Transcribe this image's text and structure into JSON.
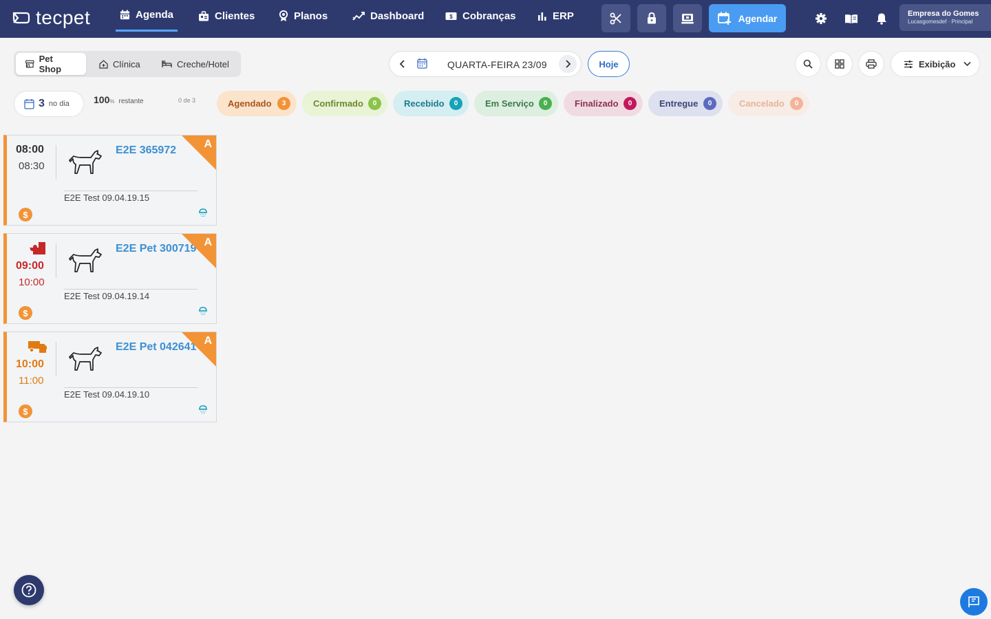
{
  "brand": {
    "logo_text": "tecpet"
  },
  "nav": [
    {
      "label": "Agenda",
      "icon": "calendar-icon",
      "active": true
    },
    {
      "label": "Clientes",
      "icon": "clients-icon"
    },
    {
      "label": "Planos",
      "icon": "badge-icon"
    },
    {
      "label": "Dashboard",
      "icon": "trend-icon"
    },
    {
      "label": "Cobranças",
      "icon": "money-icon"
    },
    {
      "label": "ERP",
      "icon": "bar-chart-icon"
    }
  ],
  "toolbar": {
    "agendar_label": "Agendar",
    "company_name": "Empresa do Gomes",
    "company_sub": "Lucasgomesdef · Principal"
  },
  "segments": [
    {
      "label": "Pet Shop",
      "active": true
    },
    {
      "label": "Clínica"
    },
    {
      "label": "Creche/Hotel"
    }
  ],
  "date_nav": {
    "label": "QUARTA-FEIRA 23/09",
    "today_label": "Hoje"
  },
  "display_label": "Exibição",
  "summary": {
    "count": "3",
    "count_label": "no dia",
    "percent": "100",
    "percent_sign": "%",
    "remaining_label": "restante",
    "of_label": "0 de 3"
  },
  "statuses": [
    {
      "label": "Agendado",
      "count": "3",
      "bg": "#fbe3cc",
      "fg": "#a9561a",
      "badge": "#f29336"
    },
    {
      "label": "Confirmado",
      "count": "0",
      "bg": "#e9f3d6",
      "fg": "#6b8a2d",
      "badge": "#8bc34a"
    },
    {
      "label": "Recebido",
      "count": "0",
      "bg": "#d4eef2",
      "fg": "#1f7a8c",
      "badge": "#17a2b8"
    },
    {
      "label": "Em Serviço",
      "count": "0",
      "bg": "#dcefe0",
      "fg": "#3f7a49",
      "badge": "#4caf50"
    },
    {
      "label": "Finalizado",
      "count": "0",
      "bg": "#f1dbe3",
      "fg": "#8a3254",
      "badge": "#c2185b"
    },
    {
      "label": "Entregue",
      "count": "0",
      "bg": "#dde0ef",
      "fg": "#3d4478",
      "badge": "#5c6bc0"
    },
    {
      "label": "Cancelado",
      "count": "0",
      "bg": "#f7ece6",
      "fg": "#e8b49a",
      "badge": "#f4b39a"
    }
  ],
  "appointments": [
    {
      "start": "08:00",
      "end": "08:30",
      "pet": "E2E 365972",
      "tutor": "E2E Test 09.04.19.15",
      "tag": "A",
      "time_color": "#333333",
      "badge_icon": ""
    },
    {
      "start": "09:00",
      "end": "10:00",
      "pet": "E2E Pet 300719",
      "tutor": "E2E Test 09.04.19.14",
      "tag": "A",
      "time_color": "#c62828",
      "badge_icon": "puzzle-icon"
    },
    {
      "start": "10:00",
      "end": "11:00",
      "pet": "E2E Pet 042641",
      "tutor": "E2E Test 09.04.19.10",
      "tag": "A",
      "time_color": "#e07b12",
      "badge_icon": "truck-icon"
    }
  ],
  "colors": {
    "topbar": "#2e3a6e",
    "accent": "#4a9cf2",
    "card_accent": "#f29336"
  }
}
